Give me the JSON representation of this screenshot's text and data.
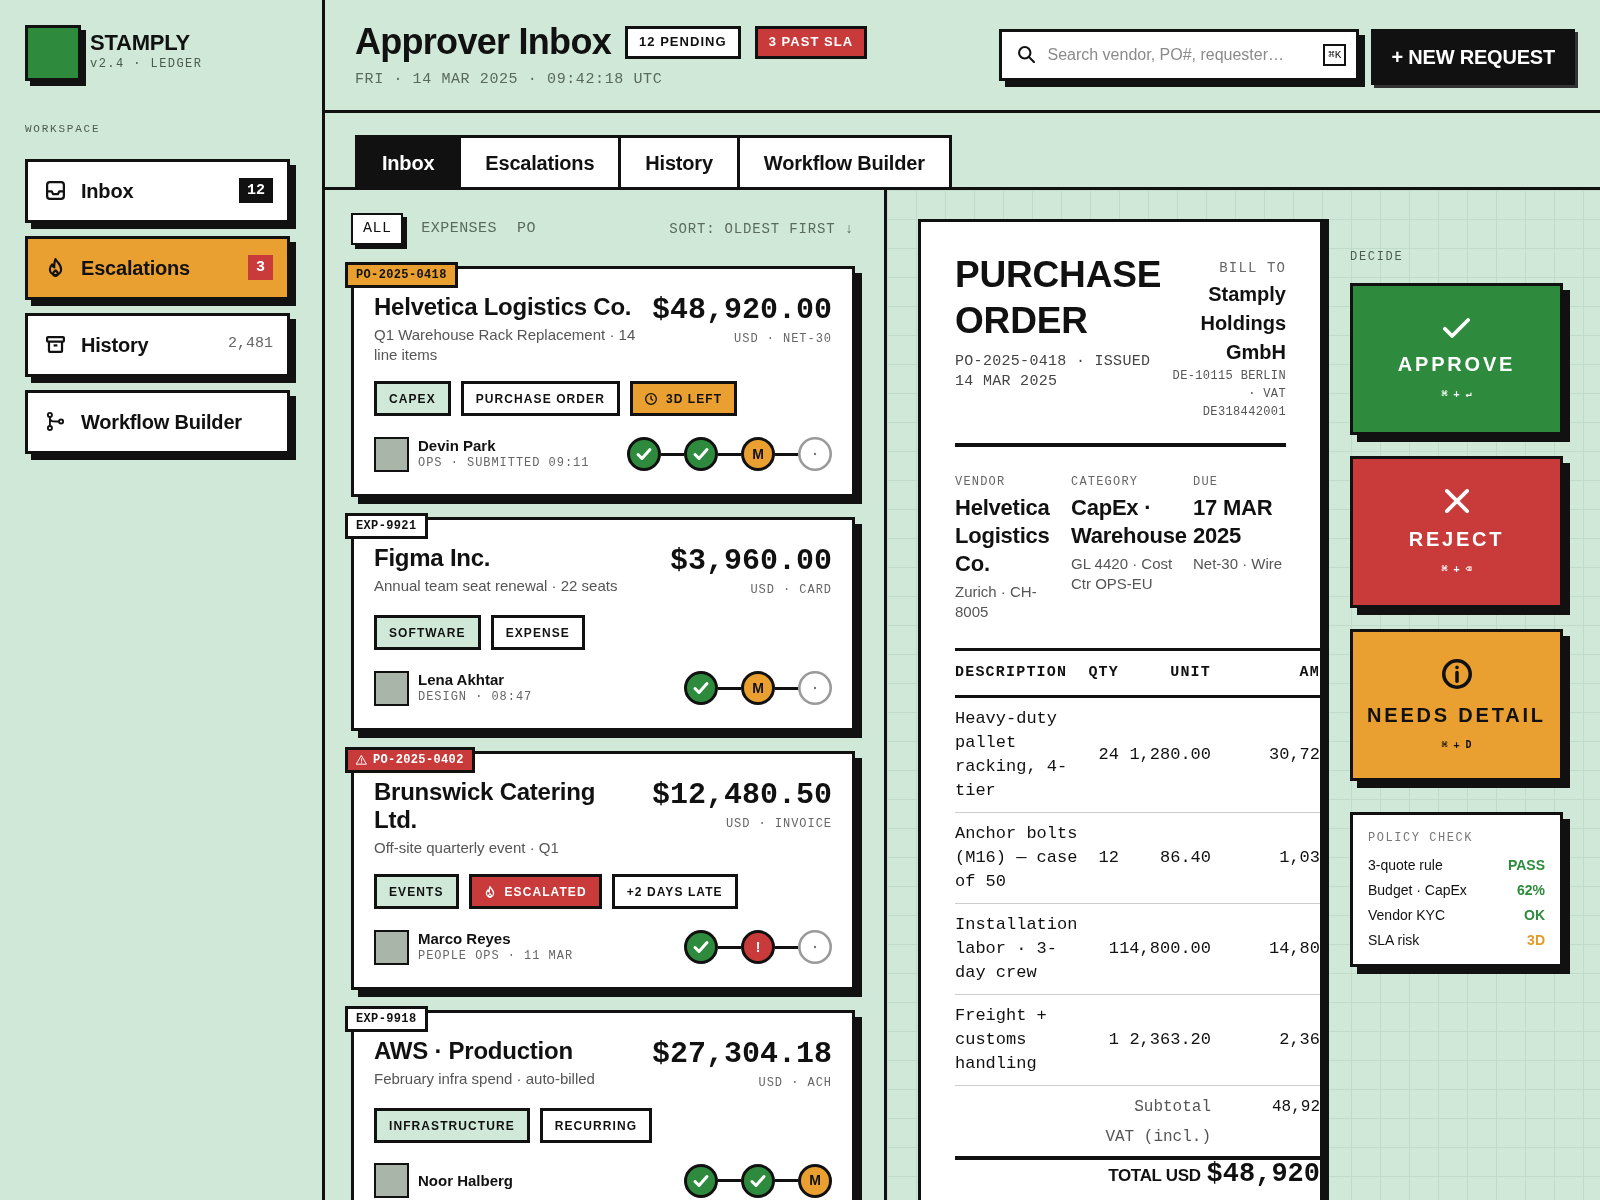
{
  "sidebar": {
    "brand": "STAMPLY",
    "version": "v2.4 · LEDGER",
    "section": "WORKSPACE",
    "items": [
      {
        "label": "Inbox",
        "count": {
          "text": "12",
          "kind": "dark"
        },
        "selected": false
      },
      {
        "label": "Escalations",
        "count": {
          "text": "3",
          "kind": "alert"
        },
        "selected": true
      },
      {
        "label": "History",
        "count": {
          "text": "2,481",
          "kind": "plain"
        },
        "selected": false
      },
      {
        "label": "Workflow Builder",
        "selected": false
      }
    ]
  },
  "header": {
    "title": "Approver Inbox",
    "badges": [
      {
        "text": "12 PENDING",
        "kind": "outline"
      },
      {
        "text": "3 PAST SLA",
        "kind": "alert"
      }
    ],
    "timestamp": "FRI · 14 MAR 2025 · 09:42:18 UTC",
    "search": {
      "placeholder": "Search vendor, PO#, requester…",
      "shortcut": "⌘K"
    },
    "new_button": "+ NEW REQUEST"
  },
  "tabs": [
    {
      "label": "Inbox",
      "selected": true
    },
    {
      "label": "Escalations",
      "selected": false
    },
    {
      "label": "History",
      "selected": false
    },
    {
      "label": "Workflow Builder",
      "selected": false
    }
  ],
  "list": {
    "filters": [
      {
        "label": "ALL",
        "selected": true
      },
      {
        "label": "EXPENSES",
        "selected": false
      },
      {
        "label": "PO",
        "selected": false
      }
    ],
    "sort": "SORT: OLDEST FIRST ↓",
    "cards": [
      {
        "reference": {
          "text": "PO-2025-0418",
          "kind": "due"
        },
        "vendor": "Helvetica Logistics Co.",
        "description": "Q1 Warehouse Rack Replacement · 14 line items",
        "amount": "$48,920.00",
        "terms": "USD · NET-30",
        "tags": [
          {
            "text": "CAPEX",
            "kind": "category"
          },
          {
            "text": "PURCHASE ORDER",
            "kind": "doc_type"
          },
          {
            "text": "3D LEFT",
            "kind": "due"
          }
        ],
        "requester": "Devin Park",
        "requester_meta": "OPS · SUBMITTED 09:11",
        "steps": [
          {
            "kind": "done"
          },
          {
            "kind": "done"
          },
          {
            "kind": "current",
            "label": "M"
          },
          {
            "kind": "pending"
          }
        ]
      },
      {
        "reference": {
          "text": "EXP-9921",
          "kind": "normal"
        },
        "vendor": "Figma Inc.",
        "description": "Annual team seat renewal · 22 seats",
        "amount": "$3,960.00",
        "terms": "USD · CARD",
        "tags": [
          {
            "text": "SOFTWARE",
            "kind": "category"
          },
          {
            "text": "EXPENSE",
            "kind": "doc_type"
          }
        ],
        "requester": "Lena Akhtar",
        "requester_meta": "DESIGN · 08:47",
        "steps": [
          {
            "kind": "done"
          },
          {
            "kind": "current",
            "label": "M"
          },
          {
            "kind": "pending"
          }
        ]
      },
      {
        "reference": {
          "text": "PO-2025-0402",
          "kind": "breached"
        },
        "vendor": "Brunswick Catering Ltd.",
        "description": "Off-site quarterly event · Q1",
        "amount": "$12,480.50",
        "terms": "USD · INVOICE",
        "tags": [
          {
            "text": "EVENTS",
            "kind": "category"
          },
          {
            "text": "ESCALATED",
            "kind": "escalated"
          },
          {
            "text": "+2 DAYS LATE",
            "kind": "late"
          }
        ],
        "requester": "Marco Reyes",
        "requester_meta": "PEOPLE OPS · 11 MAR",
        "steps": [
          {
            "kind": "done"
          },
          {
            "kind": "blocked",
            "label": "!"
          },
          {
            "kind": "pending"
          }
        ]
      },
      {
        "reference": {
          "text": "EXP-9918",
          "kind": "normal"
        },
        "vendor": "AWS · Production",
        "description": "February infra spend · auto-billed",
        "amount": "$27,304.18",
        "terms": "USD · ACH",
        "tags": [
          {
            "text": "INFRASTRUCTURE",
            "kind": "category"
          },
          {
            "text": "RECURRING",
            "kind": "doc_type"
          }
        ],
        "requester": "Noor Halberg",
        "steps": [
          {
            "kind": "done"
          },
          {
            "kind": "done"
          },
          {
            "kind": "current",
            "label": "M"
          }
        ]
      }
    ]
  },
  "document": {
    "title": "PURCHASE ORDER",
    "reference": "PO-2025-0418 · ISSUED 14 MAR 2025",
    "bill_to": {
      "label": "BILL TO",
      "name": "Stamply Holdings GmbH",
      "address": "DE-10115 BERLIN · VAT DE318442001"
    },
    "fields": [
      {
        "label": "VENDOR",
        "value": "Helvetica Logistics Co.",
        "detail": "Zurich · CH-8005"
      },
      {
        "label": "CATEGORY",
        "value": "CapEx · Warehouse",
        "detail": "GL 4420 · Cost Ctr OPS-EU"
      },
      {
        "label": "DUE",
        "value": "17 MAR 2025",
        "detail": "Net-30 · Wire"
      }
    ],
    "columns": [
      "DESCRIPTION",
      "QTY",
      "UNIT",
      "AM"
    ],
    "rows": [
      {
        "description": "Heavy-duty pallet racking, 4-tier",
        "qty": "24",
        "unit": "1,280.00",
        "column_4": "30,72"
      },
      {
        "description": "Anchor bolts (M16) — case of 50",
        "qty": "12",
        "unit": "86.40",
        "column_4": "1,03"
      },
      {
        "description": "Installation labor · 3-day crew",
        "qty": "1",
        "unit": "14,800.00",
        "column_4": "14,80"
      },
      {
        "description": "Freight + customs handling",
        "qty": "1",
        "unit": "2,363.20",
        "column_4": "2,36"
      }
    ],
    "subtotals": [
      {
        "label": "Subtotal",
        "value": "48,92"
      },
      {
        "label": "VAT (incl.)"
      }
    ],
    "total": {
      "label": "TOTAL USD",
      "value": "$48,920"
    }
  },
  "decide": {
    "title": "DECIDE",
    "actions": [
      {
        "label": "APPROVE",
        "shortcut": "⌘ + ↵",
        "kind": "approve"
      },
      {
        "label": "REJECT",
        "shortcut": "⌘ + ⌫",
        "kind": "reject"
      },
      {
        "label": "NEEDS DETAIL",
        "shortcut": "⌘ + D",
        "kind": "needs_detail"
      }
    ],
    "policy": {
      "title": "POLICY CHECK",
      "rules": [
        {
          "label": "3-quote rule",
          "result": "PASS",
          "color": "#2e8b3e"
        },
        {
          "label": "Budget · CapEx",
          "result": "62%",
          "color": "#2e8b3e"
        },
        {
          "label": "Vendor KYC",
          "result": "OK",
          "color": "#2e8b3e"
        },
        {
          "label": "SLA risk",
          "result": "3D",
          "color": "#e39a28"
        }
      ]
    }
  }
}
